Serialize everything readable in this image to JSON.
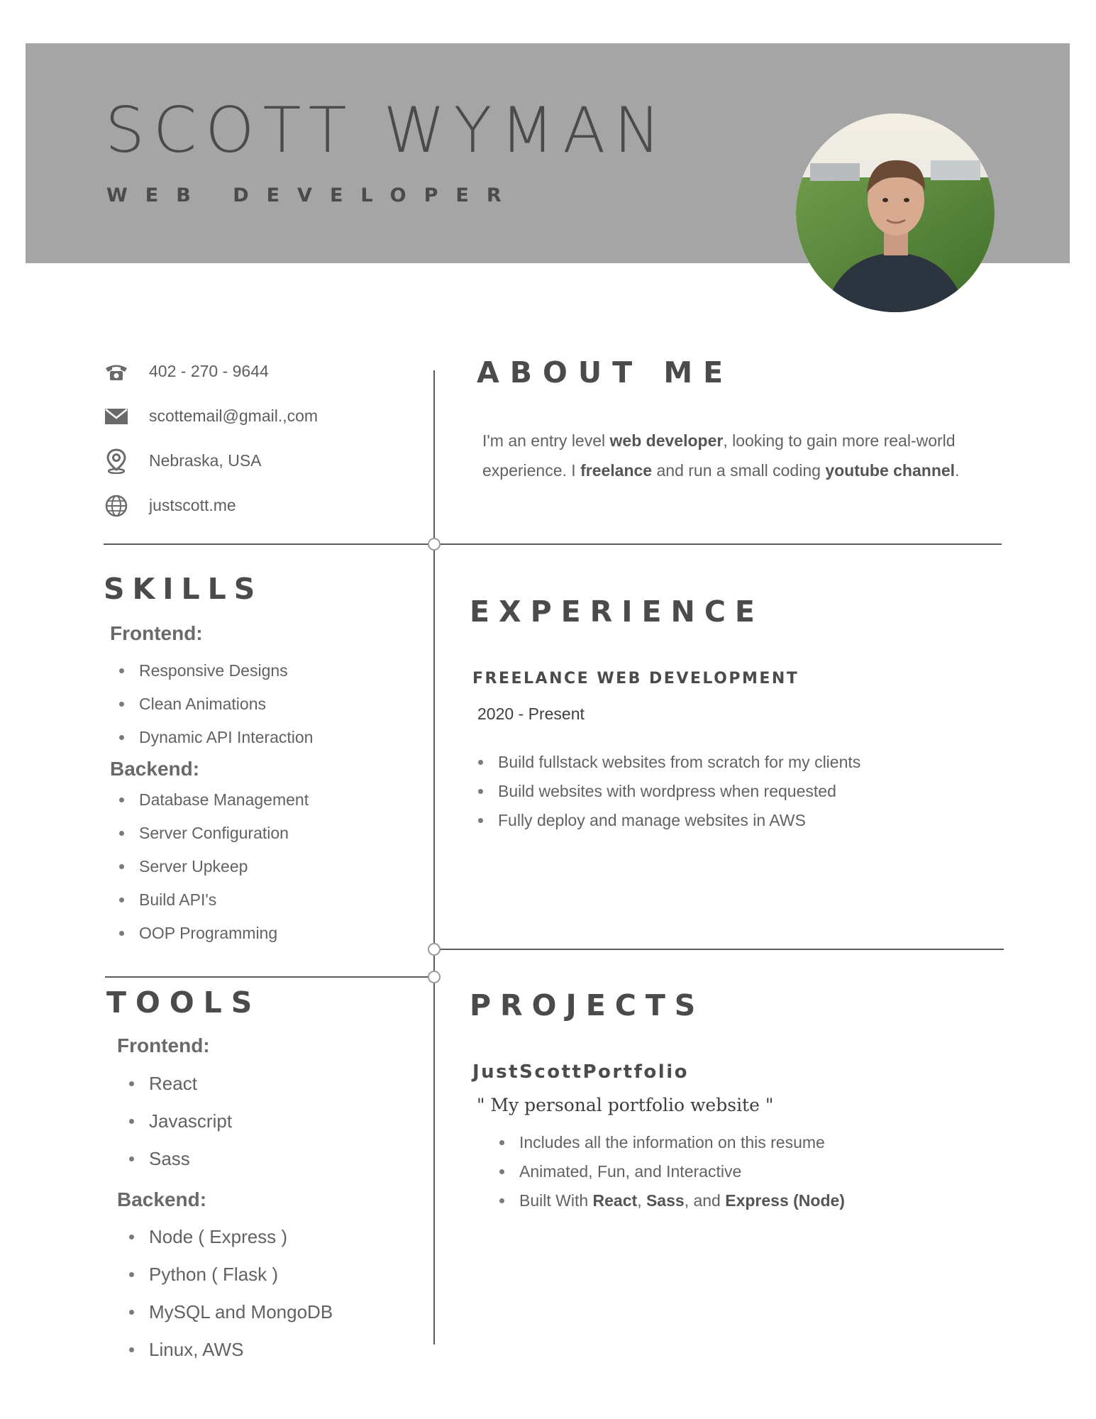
{
  "header": {
    "name": "SCOTT WYMAN",
    "role": "WEB DEVELOPER"
  },
  "contact": [
    {
      "icon": "phone-icon",
      "text": "402 - 270 - 9644"
    },
    {
      "icon": "envelope-icon",
      "text": "scottemail@gmail.,com"
    },
    {
      "icon": "location-pin-icon",
      "text": "Nebraska, USA"
    },
    {
      "icon": "globe-icon",
      "text": "justscott.me"
    }
  ],
  "about": {
    "title": "ABOUT ME",
    "t1": "I'm an entry level ",
    "b1": "web developer",
    "t2": ", looking to gain more real-world experience. I ",
    "b2": "freelance",
    "t3": " and run a small coding ",
    "b3": "youtube channel",
    "t4": "."
  },
  "skills": {
    "title": "SKILLS",
    "frontend_label": "Frontend:",
    "frontend": [
      "Responsive Designs",
      "Clean Animations",
      "Dynamic API Interaction"
    ],
    "backend_label": "Backend:",
    "backend": [
      "Database Management",
      "Server Configuration",
      "Server Upkeep",
      "Build API's",
      "OOP Programming"
    ]
  },
  "tools": {
    "title": "TOOLS",
    "frontend_label": "Frontend:",
    "frontend": [
      "React",
      "Javascript",
      "Sass"
    ],
    "backend_label": "Backend:",
    "backend": [
      "Node ( Express )",
      "Python ( Flask )",
      "MySQL and MongoDB",
      "Linux, AWS"
    ]
  },
  "experience": {
    "title": "EXPERIENCE",
    "job_title": "FREELANCE WEB DEVELOPMENT",
    "date": "2020 - Present",
    "bullets": [
      "Build fullstack websites from scratch for my clients",
      "Build websites with wordpress when requested",
      "Fully deploy and manage websites in AWS"
    ]
  },
  "projects": {
    "title": "PROJECTS",
    "name": "JustScottPortfolio",
    "quote": "\" My personal portfolio website \"",
    "bullet1": "Includes all the information on this resume",
    "bullet2": "Animated, Fun, and Interactive",
    "b3_pre": "Built With ",
    "b3_react": "React",
    "b3_comma": ", ",
    "b3_sass": "Sass",
    "b3_and": ", and ",
    "b3_express": "Express (Node)"
  },
  "colors": {
    "header_bg": "#a5a5a5",
    "heading": "#4b4b4d",
    "body_text": "#626264"
  }
}
